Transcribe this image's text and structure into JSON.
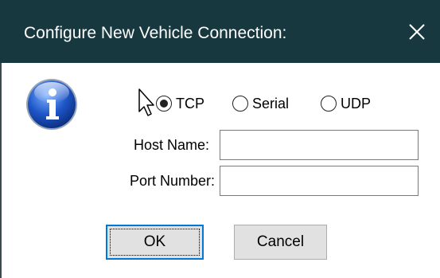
{
  "dialog": {
    "title": "Configure New Vehicle Connection:",
    "close_glyph": "✕"
  },
  "icons": {
    "info": "info-icon",
    "close": "close-icon",
    "cursor": "mouse-pointer-icon"
  },
  "connection_type": {
    "options": [
      {
        "label": "TCP",
        "selected": true
      },
      {
        "label": "Serial",
        "selected": false
      },
      {
        "label": "UDP",
        "selected": false
      }
    ]
  },
  "fields": {
    "host_name_label": "Host Name:",
    "host_name_value": "",
    "port_number_label": "Port Number:",
    "port_number_value": ""
  },
  "buttons": {
    "ok_label": "OK",
    "cancel_label": "Cancel"
  },
  "colors": {
    "titlebar": "#17383f",
    "title_text": "#ffffff",
    "default_button_border": "#0078d7",
    "button_bg": "#e1e1e1"
  }
}
